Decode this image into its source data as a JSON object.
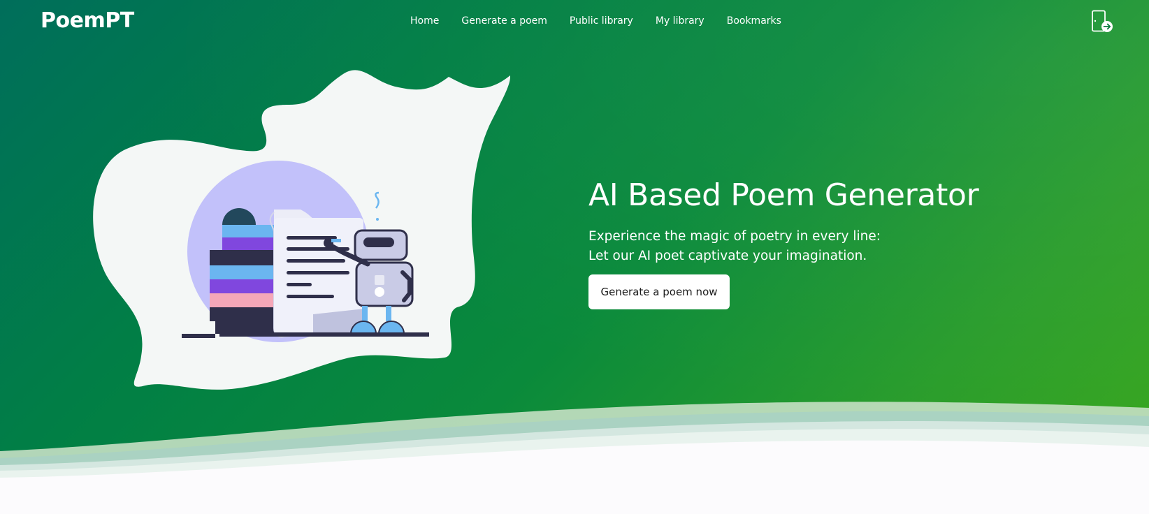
{
  "brand": "PoemPT",
  "nav": {
    "items": [
      {
        "label": "Home"
      },
      {
        "label": "Generate a poem"
      },
      {
        "label": "Public library"
      },
      {
        "label": "My library"
      },
      {
        "label": "Bookmarks"
      }
    ]
  },
  "header": {
    "login_icon": "door-enter-icon"
  },
  "hero": {
    "title": "AI Based Poem Generator",
    "subtitle_line1": "Experience the magic of poetry in every line:",
    "subtitle_line2": "Let our AI poet captivate your imagination.",
    "cta_label": "Generate a poem now",
    "illustration_icon": "robot-writing-poem-illustration"
  },
  "colors": {
    "hero_gradient_start": "#006e5b",
    "hero_gradient_end": "#3ba81f",
    "blob": "#f4f7f6",
    "robot_body": "#c9cbe6",
    "robot_outline": "#2f2f4a",
    "circle": "#c2c1fa",
    "book_blue": "#6bb6f0",
    "book_purple": "#8047de",
    "book_pink": "#f5a7b8",
    "button_bg": "#ffffff"
  }
}
